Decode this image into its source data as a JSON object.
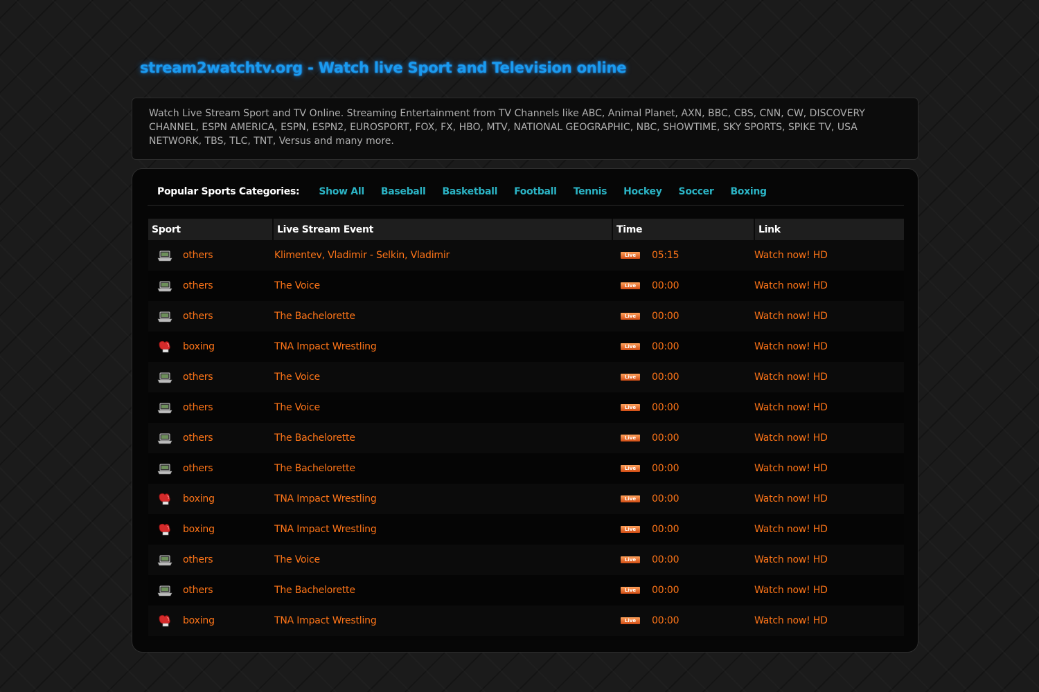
{
  "header": {
    "title": "stream2watchtv.org - Watch live Sport and Television online"
  },
  "description": "Watch Live Stream Sport and TV Online. Streaming Entertainment from TV Channels like ABC, Animal Planet, AXN, BBC, CBS, CNN, CW, DISCOVERY CHANNEL, ESPN AMERICA, ESPN, ESPN2, EUROSPORT, FOX, FX, HBO, MTV, NATIONAL GEOGRAPHIC, NBC, SHOWTIME, SKY SPORTS, SPIKE TV, USA NETWORK, TBS, TLC, TNT, Versus and many more.",
  "categories": {
    "label": "Popular Sports Categories:",
    "items": [
      "Show All",
      "Baseball",
      "Basketball",
      "Football",
      "Tennis",
      "Hockey",
      "Soccer",
      "Boxing"
    ]
  },
  "table": {
    "columns": [
      "Sport",
      "Live Stream Event",
      "Time",
      "Link"
    ],
    "live_badge": "Live",
    "rows": [
      {
        "sport": "others",
        "icon": "laptop-icon",
        "event": "Klimentev, Vladimir - Selkin, Vladimir",
        "time": "05:15",
        "link": "Watch now! HD"
      },
      {
        "sport": "others",
        "icon": "laptop-icon",
        "event": "The Voice",
        "time": "00:00",
        "link": "Watch now! HD"
      },
      {
        "sport": "others",
        "icon": "laptop-icon",
        "event": "The Bachelorette",
        "time": "00:00",
        "link": "Watch now! HD"
      },
      {
        "sport": "boxing",
        "icon": "boxing-glove-icon",
        "event": "TNA Impact Wrestling",
        "time": "00:00",
        "link": "Watch now! HD"
      },
      {
        "sport": "others",
        "icon": "laptop-icon",
        "event": "The Voice",
        "time": "00:00",
        "link": "Watch now! HD"
      },
      {
        "sport": "others",
        "icon": "laptop-icon",
        "event": "The Voice",
        "time": "00:00",
        "link": "Watch now! HD"
      },
      {
        "sport": "others",
        "icon": "laptop-icon",
        "event": "The Bachelorette",
        "time": "00:00",
        "link": "Watch now! HD"
      },
      {
        "sport": "others",
        "icon": "laptop-icon",
        "event": "The Bachelorette",
        "time": "00:00",
        "link": "Watch now! HD"
      },
      {
        "sport": "boxing",
        "icon": "boxing-glove-icon",
        "event": "TNA Impact Wrestling",
        "time": "00:00",
        "link": "Watch now! HD"
      },
      {
        "sport": "boxing",
        "icon": "boxing-glove-icon",
        "event": "TNA Impact Wrestling",
        "time": "00:00",
        "link": "Watch now! HD"
      },
      {
        "sport": "others",
        "icon": "laptop-icon",
        "event": "The Voice",
        "time": "00:00",
        "link": "Watch now! HD"
      },
      {
        "sport": "others",
        "icon": "laptop-icon",
        "event": "The Bachelorette",
        "time": "00:00",
        "link": "Watch now! HD"
      },
      {
        "sport": "boxing",
        "icon": "boxing-glove-icon",
        "event": "TNA Impact Wrestling",
        "time": "00:00",
        "link": "Watch now! HD"
      }
    ]
  },
  "colors": {
    "title": "#1a9bf0",
    "category_link": "#2bb3c4",
    "row_text": "#ff7518"
  }
}
